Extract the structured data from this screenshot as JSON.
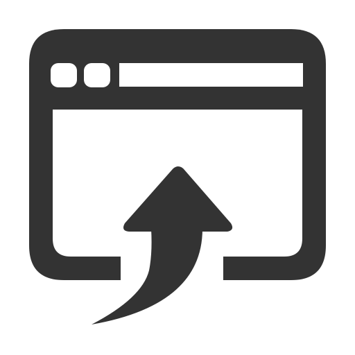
{
  "icon": {
    "name": "web-upload-icon",
    "color": "#333333",
    "background": "#ffffff",
    "parts": {
      "window": "browser-window-icon",
      "buttons": [
        "window-dot-icon",
        "window-dot-icon"
      ],
      "address_bar": "address-bar-slot",
      "arrow": "curved-upload-arrow-icon"
    }
  }
}
